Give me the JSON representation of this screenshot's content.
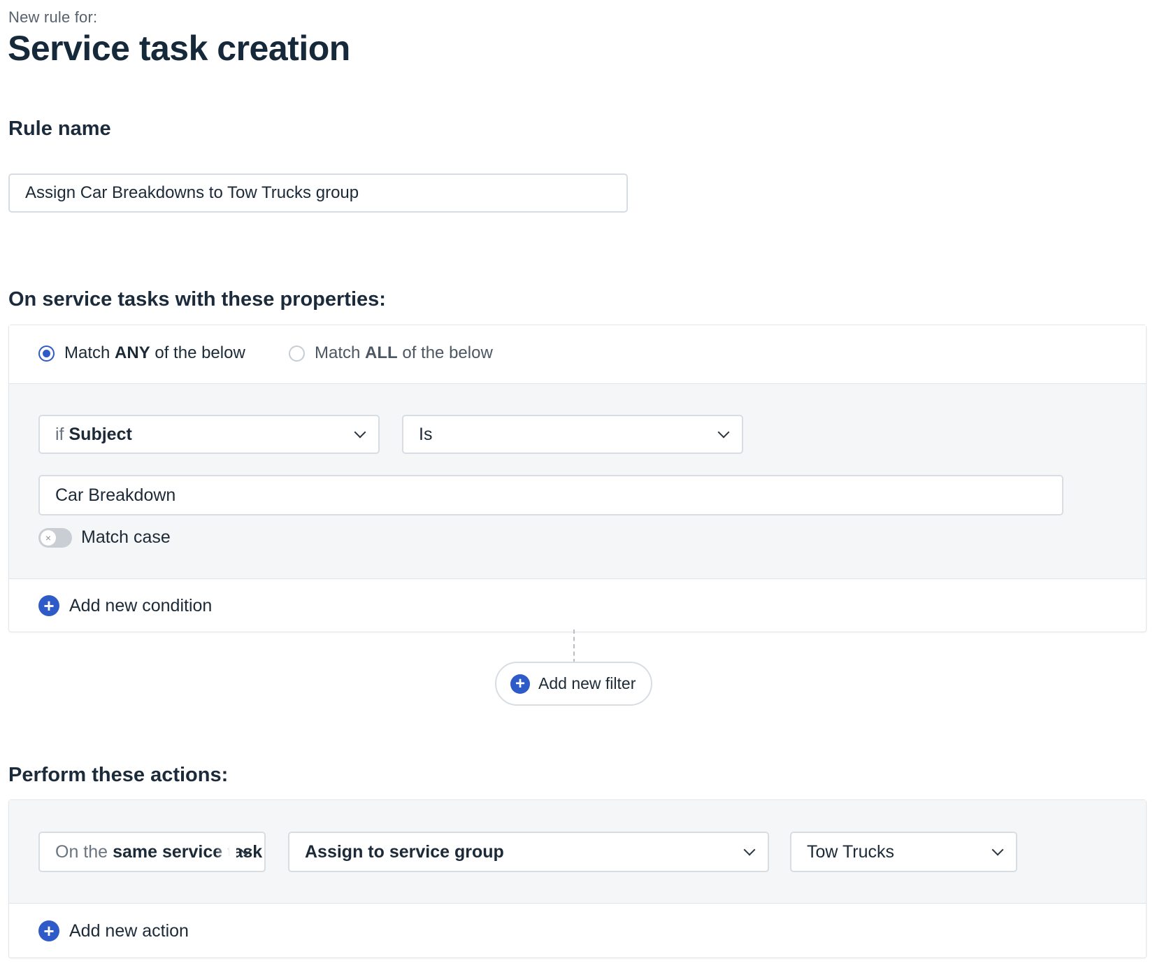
{
  "header": {
    "subtitle": "New rule for:",
    "title": "Service task creation"
  },
  "rule_name": {
    "heading": "Rule name",
    "value": "Assign Car Breakdowns to Tow Trucks group"
  },
  "conditions": {
    "heading": "On service tasks with these properties:",
    "match_any": {
      "pre": "Match ",
      "bold": "ANY",
      "post": " of the below",
      "selected": true
    },
    "match_all": {
      "pre": "Match ",
      "bold": "ALL",
      "post": " of the below",
      "selected": false
    },
    "field_select": {
      "prefix": "if",
      "value": "Subject"
    },
    "operator_select": {
      "value": "Is"
    },
    "value_input": "Car Breakdown",
    "match_case": {
      "label": "Match case",
      "enabled": false
    },
    "add_condition_label": "Add new condition",
    "add_filter_label": "Add new filter"
  },
  "actions": {
    "heading": "Perform these actions:",
    "target_select": {
      "prefix": "On the",
      "value": "same service task"
    },
    "action_select": {
      "value": "Assign to service group"
    },
    "group_select": {
      "value": "Tow Trucks"
    },
    "add_action_label": "Add new action"
  },
  "colors": {
    "accent": "#2e5bc8",
    "panel_bg": "#f5f6f8",
    "border": "#d8dde3"
  }
}
